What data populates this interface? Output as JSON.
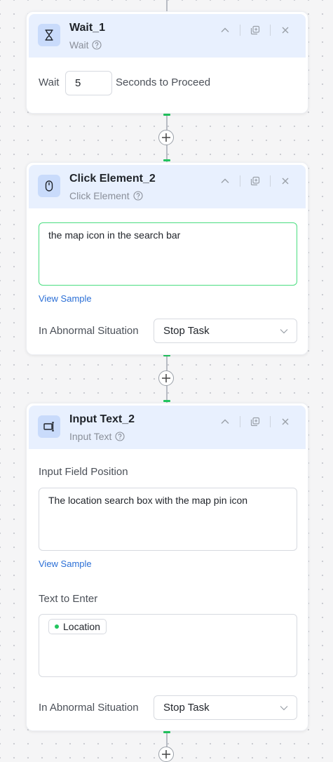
{
  "nodes": {
    "wait": {
      "title": "Wait_1",
      "subtitle": "Wait",
      "prefix": "Wait",
      "value": "5",
      "suffix": "Seconds to Proceed"
    },
    "click": {
      "title": "Click Element_2",
      "subtitle": "Click Element",
      "target": "the map icon in the search bar",
      "view_sample": "View Sample",
      "abnormal_label": "In Abnormal Situation",
      "abnormal_value": "Stop Task"
    },
    "input": {
      "title": "Input Text_2",
      "subtitle": "Input Text",
      "position_label": "Input Field Position",
      "position_value": "The location search box with the map pin icon",
      "view_sample": "View Sample",
      "text_label": "Text to Enter",
      "variable_tag": "Location",
      "abnormal_label": "In Abnormal Situation",
      "abnormal_value": "Stop Task"
    }
  },
  "colors": {
    "header_bg": "#e8f0fe",
    "icon_bg": "#c9dbfb",
    "accent_green": "#22c55e",
    "link_blue": "#2b6fd6"
  },
  "icons": {
    "wait": "hourglass-icon",
    "click": "mouse-icon",
    "input": "input-field-icon",
    "collapse": "chevron-up-icon",
    "copy": "copy-icon",
    "close": "close-icon",
    "help": "help-circle-icon",
    "add": "plus-icon",
    "dropdown": "chevron-down-icon"
  }
}
